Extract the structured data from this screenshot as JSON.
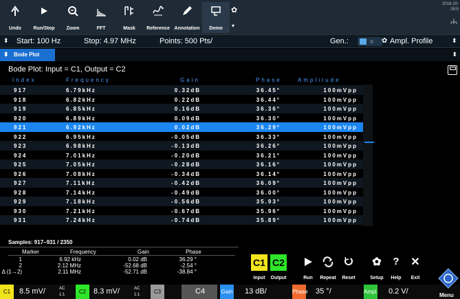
{
  "toolbar": {
    "buttons": [
      {
        "label": "Undo",
        "icon": "undo-icon"
      },
      {
        "label": "Run/Stop",
        "icon": "play-icon"
      },
      {
        "label": "Zoom",
        "icon": "zoom-icon"
      },
      {
        "label": "FFT",
        "icon": "fft-icon"
      },
      {
        "label": "Mask",
        "icon": "mask-icon"
      },
      {
        "label": "Reference",
        "icon": "reference-icon"
      },
      {
        "label": "Annotation",
        "icon": "pen-icon"
      },
      {
        "label": "Demo",
        "icon": "demo-icon"
      }
    ],
    "datetime_line1": "2018-10-",
    "datetime_line2": "09:5"
  },
  "settings": {
    "start": "Start: 100 Hz",
    "stop": "Stop: 4.97 MHz",
    "points": "Points: 500 Pts/",
    "gen": "Gen.:",
    "ampl_profile": "Ampl. Profile"
  },
  "bode": {
    "tab_label": "Bode Plot",
    "header": "Bode Plot: Input = C1, Output = C2",
    "columns": [
      "Index",
      "Frequency",
      "Gain",
      "Phase",
      "Amplitude"
    ],
    "rows": [
      {
        "index": "917",
        "freq": "6.79kHz",
        "gain": "0.32dB",
        "phase": "36.45°",
        "amp": "100mVpp"
      },
      {
        "index": "918",
        "freq": "6.82kHz",
        "gain": "0.22dB",
        "phase": "36.44°",
        "amp": "100mVpp"
      },
      {
        "index": "919",
        "freq": "6.85kHz",
        "gain": "0.16dB",
        "phase": "36.36°",
        "amp": "100mVpp"
      },
      {
        "index": "920",
        "freq": "6.89kHz",
        "gain": "0.09dB",
        "phase": "36.30°",
        "amp": "100mVpp"
      },
      {
        "index": "921",
        "freq": "6.92kHz",
        "gain": "0.02dB",
        "phase": "36.29°",
        "amp": "100mVpp"
      },
      {
        "index": "922",
        "freq": "6.95kHz",
        "gain": "-0.05dB",
        "phase": "36.33°",
        "amp": "100mVpp"
      },
      {
        "index": "923",
        "freq": "6.98kHz",
        "gain": "-0.13dB",
        "phase": "36.26°",
        "amp": "100mVpp"
      },
      {
        "index": "924",
        "freq": "7.01kHz",
        "gain": "-0.20dB",
        "phase": "36.21°",
        "amp": "100mVpp"
      },
      {
        "index": "925",
        "freq": "7.05kHz",
        "gain": "-0.28dB",
        "phase": "36.16°",
        "amp": "100mVpp"
      },
      {
        "index": "926",
        "freq": "7.08kHz",
        "gain": "-0.34dB",
        "phase": "36.14°",
        "amp": "100mVpp"
      },
      {
        "index": "927",
        "freq": "7.11kHz",
        "gain": "-0.42dB",
        "phase": "36.09°",
        "amp": "100mVpp"
      },
      {
        "index": "928",
        "freq": "7.14kHz",
        "gain": "-0.49dB",
        "phase": "36.00°",
        "amp": "100mVpp"
      },
      {
        "index": "929",
        "freq": "7.18kHz",
        "gain": "-0.56dB",
        "phase": "35.93°",
        "amp": "100mVpp"
      },
      {
        "index": "930",
        "freq": "7.21kHz",
        "gain": "-0.67dB",
        "phase": "35.96°",
        "amp": "100mVpp"
      },
      {
        "index": "931",
        "freq": "7.24kHz",
        "gain": "-0.74dB",
        "phase": "35.89°",
        "amp": "100mVpp"
      }
    ],
    "selected_index": "921",
    "samples": "Samples: 917–931 / 2350"
  },
  "markers": {
    "columns": [
      "Marker",
      "Frequency",
      "Gain",
      "Phase"
    ],
    "rows": [
      {
        "marker": "1",
        "freq": "6.92 kHz",
        "gain": "0.02 dB",
        "phase": "36.29 °"
      },
      {
        "marker": "2",
        "freq": "2.12 MHz",
        "gain": "-52.68 dB",
        "phase": "-2.54 °"
      },
      {
        "marker": "Δ (1→2)",
        "freq": "2.11 MHz",
        "gain": "-52.71 dB",
        "phase": "-38.84 °"
      }
    ]
  },
  "controls": {
    "input_label": "Input",
    "output_label": "Output",
    "input_channel": "C1",
    "output_channel": "C2",
    "run": "Run",
    "repeat": "Repeat",
    "reset": "Reset",
    "setup": "Setup",
    "help": "Help",
    "exit": "Exit"
  },
  "status": {
    "c1_tag": "C1",
    "c1_val": "8.5 mV/",
    "c1_sub1": "AC",
    "c1_sub2": "1:1",
    "c2_tag": "C2",
    "c2_val": "8.3 mV/",
    "c2_sub1": "AC",
    "c2_sub2": "1:1",
    "c3_tag": "C3",
    "c4_tag": "C4",
    "gain_tag": "Gain",
    "gain_val": "13 dB/",
    "phase_tag": "Phase",
    "phase_val": "35 °/",
    "ampl_tag": "Ampl.",
    "ampl_val": "0.2 V/",
    "menu": "Menu"
  },
  "colors": {
    "accent": "#1b86f0",
    "c1": "#f2e41c",
    "c2": "#2ee629",
    "c3": "#9a9a9a",
    "gain": "#2b8ff0",
    "phase": "#ef6b2e",
    "ampl": "#2ec43a"
  }
}
